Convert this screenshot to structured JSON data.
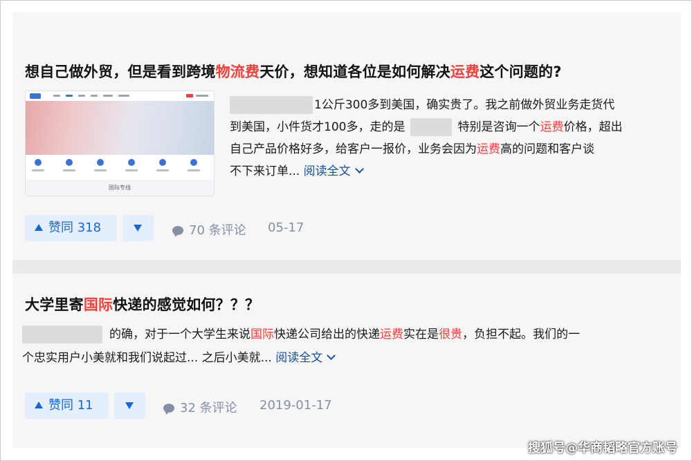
{
  "answers": [
    {
      "title_parts": [
        {
          "text": "想自己做外贸，但是看到跨境",
          "hl": false
        },
        {
          "text": "物流费",
          "hl": true
        },
        {
          "text": "天价，想知道各位是如何解决",
          "hl": false
        },
        {
          "text": "运费",
          "hl": true
        },
        {
          "text": "这个问题的?",
          "hl": false
        }
      ],
      "thumbnail_caption": "国际专线",
      "excerpt_lines": [
        [
          {
            "text": "1公斤300多到美国，确实贵了。我之前做外贸业务走货代",
            "hl": false
          }
        ],
        [
          {
            "text": "到美国，小件货才100多，走的是",
            "hl": false
          },
          {
            "text": "特别是咨询一个",
            "hl": false
          },
          {
            "text": "运费",
            "hl": true
          },
          {
            "text": "价格，超出",
            "hl": false
          }
        ],
        [
          {
            "text": "自己产品价格好多，给客户一报价，业务会因为",
            "hl": false
          },
          {
            "text": "运费",
            "hl": true
          },
          {
            "text": "高的问题和客户谈",
            "hl": false
          }
        ],
        [
          {
            "text": "不下来订单...",
            "hl": false
          }
        ]
      ],
      "read_more": "阅读全文",
      "upvote_label": "赞同 318",
      "comments_label": "70 条评论",
      "date": "05-17"
    },
    {
      "title_parts": [
        {
          "text": "大学里寄",
          "hl": false
        },
        {
          "text": "国际",
          "hl": true
        },
        {
          "text": "快递的感觉如何？？？",
          "hl": false
        }
      ],
      "excerpt_lines": [
        [
          {
            "text": "的确，对于一个大学生来说",
            "hl": false
          },
          {
            "text": "国际",
            "hl": true
          },
          {
            "text": "快递公司给出的快递",
            "hl": false
          },
          {
            "text": "运费",
            "hl": true
          },
          {
            "text": "实在是",
            "hl": false
          },
          {
            "text": "很贵",
            "hl": true
          },
          {
            "text": "，负担不起。我们的一",
            "hl": false
          }
        ],
        [
          {
            "text": "个忠实用户小美就和我们说起过... 之后小美就...",
            "hl": false
          }
        ]
      ],
      "read_more": "阅读全文",
      "upvote_label": "赞同 11",
      "comments_label": "32 条评论",
      "date": "2019-01-17"
    }
  ],
  "watermark": "搜狐号@华商韬略官方账号",
  "colors": {
    "highlight": "#f1403c",
    "link": "#175199",
    "vote": "#1768d3",
    "vote_bg": "#e5eefb",
    "meta": "#8590a6"
  },
  "icons": [
    "arrow-up-icon",
    "arrow-down-icon",
    "comment-icon",
    "chevron-down-icon"
  ]
}
